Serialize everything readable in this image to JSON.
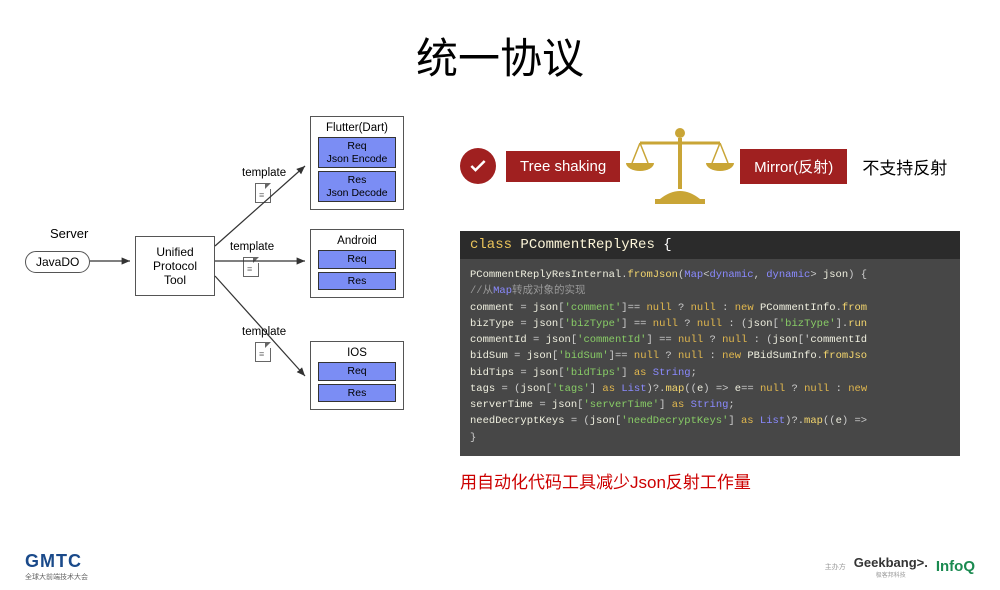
{
  "title": "统一协议",
  "diagram": {
    "server_label": "Server",
    "java_do": "JavaDO",
    "upt": "Unified Protocol Tool",
    "template": "template",
    "flutter": {
      "title": "Flutter(Dart)",
      "req": "Req",
      "req2": "Json Encode",
      "res": "Res",
      "res2": "Json Decode"
    },
    "android": {
      "title": "Android",
      "req": "Req",
      "res": "Res"
    },
    "ios": {
      "title": "IOS",
      "req": "Req",
      "res": "Res"
    }
  },
  "right": {
    "tree_shaking": "Tree shaking",
    "mirror": "Mirror(反射)",
    "no_reflect": "不支持反射",
    "caption": "用自动化代码工具减少Json反射工作量"
  },
  "code": {
    "class_kw": "class",
    "class_name": "PCommentReplyRes",
    "lines": [
      {
        "raw": "PCommentReplyResInternal.fromJson(Map<dynamic, dynamic> json) {"
      },
      {
        "raw": "  //从Map转成对象的实现"
      },
      {
        "raw": "  comment = json['comment']== null ? null : new PCommentInfo.from"
      },
      {
        "raw": "  bizType = json['bizType'] == null ? null : (json['bizType'].run"
      },
      {
        "raw": "  commentId = json['commentId'] == null ? null : (json['commentId"
      },
      {
        "raw": "  bidSum = json['bidSum']== null ? null : new PBidSumInfo.fromJso"
      },
      {
        "raw": "  bidTips = json['bidTips'] as String;"
      },
      {
        "raw": "  tags = (json['tags'] as List)?.map((e) => e== null ? null : new"
      },
      {
        "raw": "  serverTime = json['serverTime'] as String;"
      },
      {
        "raw": "  needDecryptKeys = (json['needDecryptKeys'] as List)?.map((e) =>"
      },
      {
        "raw": "}"
      }
    ]
  },
  "footer": {
    "gmtc": "GMTC",
    "gmtc_sub": "全球大前端技术大会",
    "sponsor": "主办方",
    "geekbang": "Geekbang>.",
    "geekbang_sub": "极客邦科技",
    "infoq": "InfoQ"
  }
}
